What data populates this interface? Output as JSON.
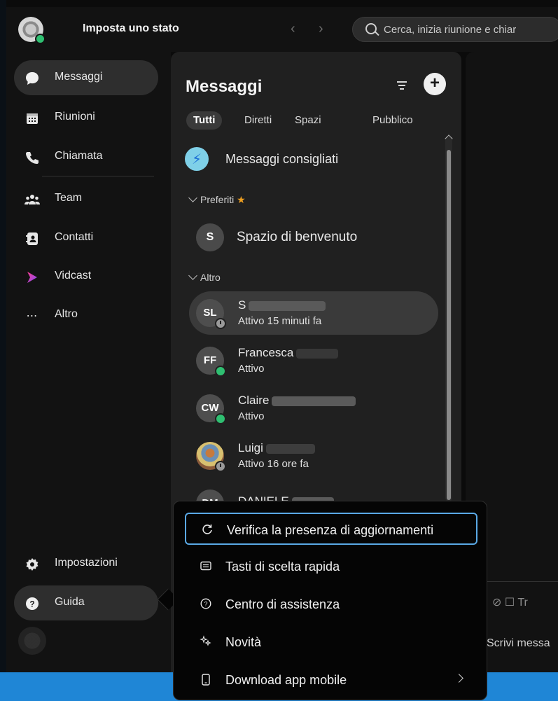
{
  "topbar": {
    "status_title": "Imposta uno stato",
    "back_icon": "chevron-left-icon",
    "forward_icon": "chevron-right-icon",
    "search_placeholder": "Cerca, inizia riunione e chiar"
  },
  "rail": {
    "items": [
      {
        "label": "Messaggi",
        "icon": "chat-bubble-icon",
        "active": true
      },
      {
        "label": "Riunioni",
        "icon": "calendar-icon"
      },
      {
        "label": "Chiamata",
        "icon": "phone-icon"
      },
      {
        "label": "Team",
        "icon": "team-icon"
      },
      {
        "label": "Contatti",
        "icon": "contacts-icon"
      },
      {
        "label": "Vidcast",
        "icon": "vidcast-icon"
      },
      {
        "label": "Altro",
        "icon": "more-icon"
      }
    ],
    "settings_label": "Impostazioni",
    "help_label": "Guida"
  },
  "panel": {
    "title": "Messaggi",
    "tabs": [
      {
        "label": "Tutti",
        "active": true
      },
      {
        "label": "Diretti"
      },
      {
        "label": "Spazi"
      },
      {
        "label": "Pubblico"
      }
    ],
    "suggested_label": "Messaggi consigliati",
    "favorites_section": "Preferiti",
    "space": {
      "initial": "S",
      "label": "Spazio di benvenuto"
    },
    "other_section": "Altro",
    "contacts": [
      {
        "initials": "SL",
        "name": "S",
        "status": "Attivo 15 minuti fa",
        "presence": "away",
        "active": true
      },
      {
        "initials": "FF",
        "name": "Francesca",
        "status": "Attivo",
        "presence": "online"
      },
      {
        "initials": "CW",
        "name": "Claire",
        "status": "Attivo",
        "presence": "online"
      },
      {
        "initials": "",
        "name": "Luigi",
        "status": "Attivo 16 ore fa",
        "presence": "away"
      },
      {
        "initials": "DM",
        "name": "DANIELE",
        "status": "",
        "presence": "online"
      }
    ]
  },
  "composer": {
    "tools": "⊘ ☐ Tr",
    "placeholder": "Scrivi messa"
  },
  "help_menu": {
    "items": [
      {
        "label": "Verifica la presenza di aggiornamenti",
        "icon": "refresh-icon",
        "focused": true
      },
      {
        "label": "Tasti di scelta rapida",
        "icon": "keyboard-icon"
      },
      {
        "label": "Centro di assistenza",
        "icon": "help-circle-icon"
      },
      {
        "label": "Novità",
        "icon": "sparkle-icon"
      },
      {
        "label": "Download app mobile",
        "icon": "mobile-phone-icon",
        "has_submenu": true
      }
    ]
  },
  "colors": {
    "accent_blue": "#1f86d6",
    "presence_green": "#2fbf71",
    "focus_ring": "#5aa9e6",
    "star": "#f0a020"
  }
}
